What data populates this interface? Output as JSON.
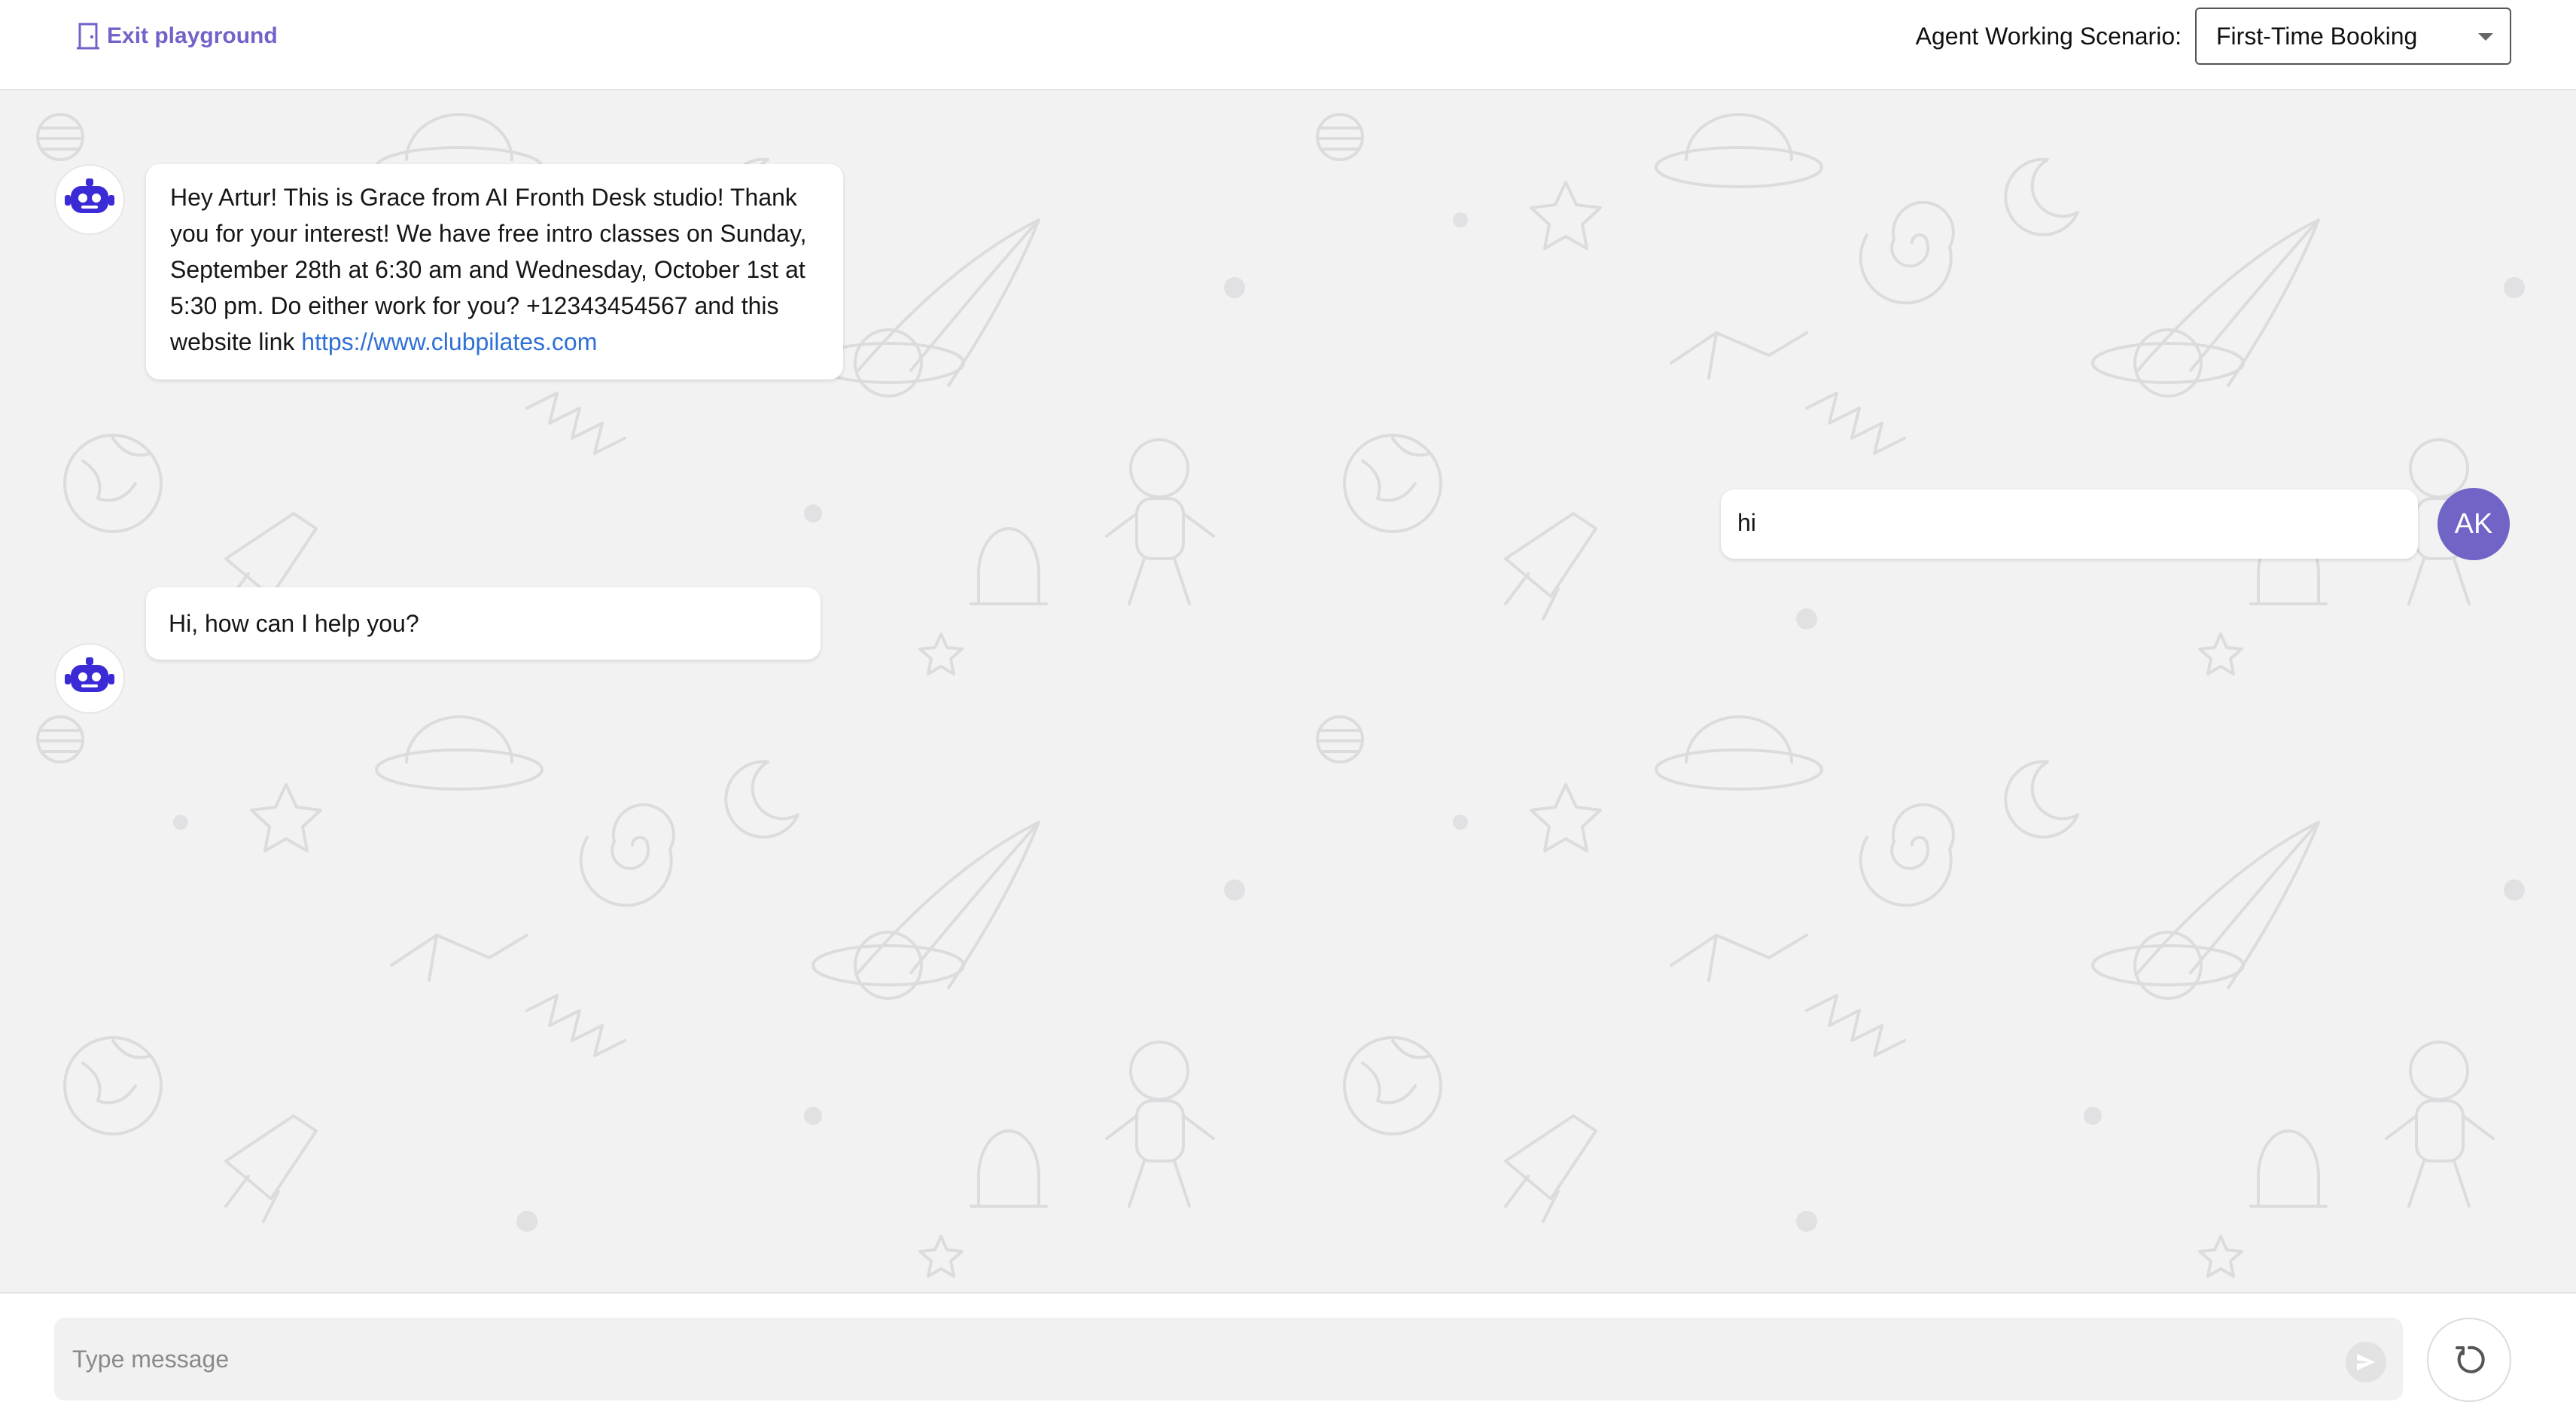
{
  "header": {
    "exit_label": "Exit playground",
    "scenario_label": "Agent Working Scenario:",
    "scenario_value": "First-Time Booking"
  },
  "messages": [
    {
      "sender": "agent",
      "text": "Hey Artur! This is Grace from AI Fronth Desk studio! Thank you for your interest! We have free intro classes on Sunday, September 28th at 6:30 am and Wednesday, October 1st at 5:30 pm. Do either work for you? +12343454567 and this website link ",
      "link": "https://www.clubpilates.com"
    },
    {
      "sender": "user",
      "text": "hi",
      "avatar_initials": "AK"
    },
    {
      "sender": "agent",
      "text": "Hi, how can I help you?"
    }
  ],
  "composer": {
    "placeholder": "Type message"
  },
  "icons": {
    "exit": "door-exit-icon",
    "bot": "robot-icon",
    "send": "send-icon",
    "reset": "refresh-icon",
    "dropdown": "chevron-down-icon"
  },
  "colors": {
    "accent": "#7163c9",
    "user_avatar": "#7164c7",
    "link": "#2f6fd6",
    "bot_icon": "#3b2bd6"
  }
}
